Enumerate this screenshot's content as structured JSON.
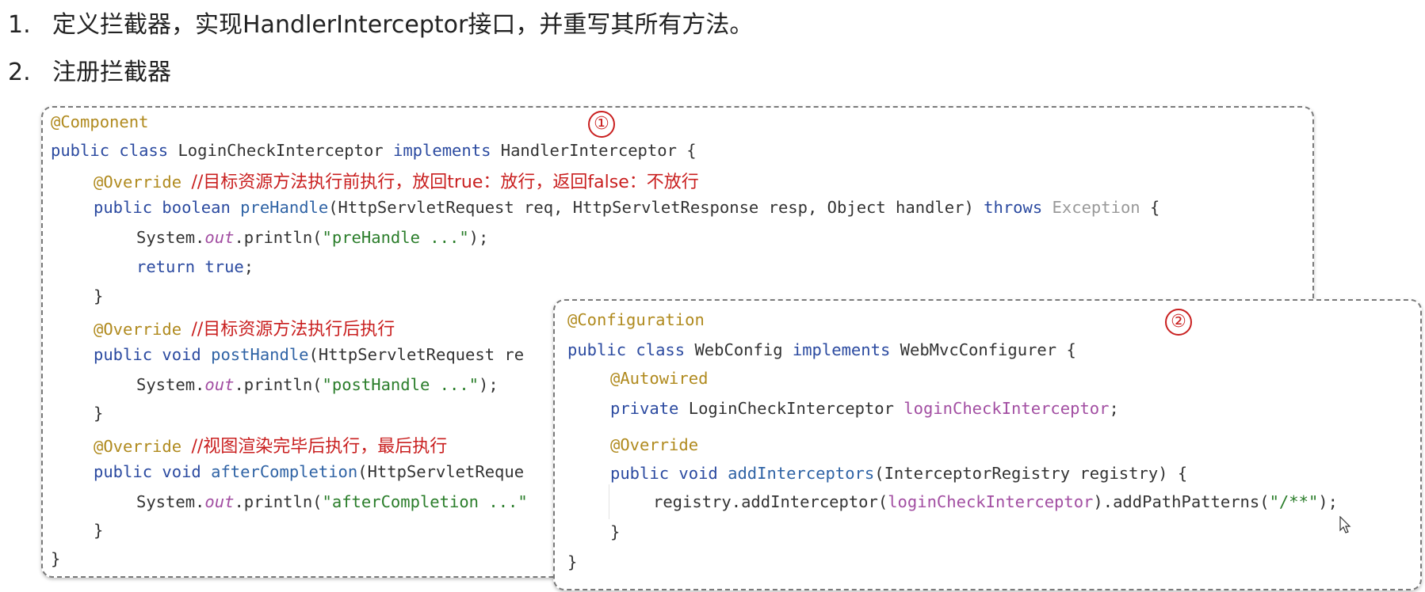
{
  "headings": [
    {
      "num": "1.",
      "text": "定义拦截器，实现HandlerInterceptor接口，并重写其所有方法。"
    },
    {
      "num": "2.",
      "text": "注册拦截器"
    }
  ],
  "box1": {
    "marker": "①",
    "l1": "@Component",
    "l2": {
      "kw1": "public class",
      "cls": " LoginCheckInterceptor ",
      "kw2": "implements",
      "rest": " HandlerInterceptor {"
    },
    "l3": {
      "ann": "@Override",
      "cmt": "//目标资源方法执行前执行，放回true：放行，返回false：不放行"
    },
    "l4": {
      "kw": "public boolean",
      "fn": " preHandle",
      "args": "(HttpServletRequest req, HttpServletResponse resp, Object handler) ",
      "throws": "throws",
      "exc": " Exception",
      "end": " {"
    },
    "l5": {
      "pre": "System.",
      "out": "out",
      "mid": ".println(",
      "str": "\"preHandle ...\"",
      "end": ");"
    },
    "l6": {
      "kw": "return true",
      "end": ";"
    },
    "l7": "}",
    "l8": {
      "ann": "@Override",
      "cmt": "//目标资源方法执行后执行"
    },
    "l9": {
      "kw": "public void",
      "fn": " postHandle",
      "args": "(HttpServletRequest re"
    },
    "l10": {
      "pre": "System.",
      "out": "out",
      "mid": ".println(",
      "str": "\"postHandle ...\"",
      "end": ");"
    },
    "l11": "}",
    "l12": {
      "ann": "@Override",
      "cmt": "//视图渲染完毕后执行，最后执行"
    },
    "l13": {
      "kw": "public void",
      "fn": " afterCompletion",
      "args": "(HttpServletReque"
    },
    "l14": {
      "pre": "System.",
      "out": "out",
      "mid": ".println(",
      "str": "\"afterCompletion ...\""
    },
    "l15": "}",
    "l16": "}"
  },
  "box2": {
    "marker": "②",
    "l1": "@Configuration",
    "l2": {
      "kw1": "public class",
      "cls": " WebConfig ",
      "kw2": "implements",
      "rest": " WebMvcConfigurer {"
    },
    "l3": "@Autowired",
    "l4": {
      "kw": "private",
      "cls": " LoginCheckInterceptor ",
      "fld": "loginCheckInterceptor",
      "end": ";"
    },
    "l5": "@Override",
    "l6": {
      "kw": "public void",
      "fn": " addInterceptors",
      "args": "(InterceptorRegistry registry) {"
    },
    "l7": {
      "pre": "registry.addInterceptor(",
      "fld": "loginCheckInterceptor",
      "mid": ").addPathPatterns(",
      "str": "\"/**\"",
      "end": ");"
    },
    "l8": "}",
    "l9": "}"
  }
}
